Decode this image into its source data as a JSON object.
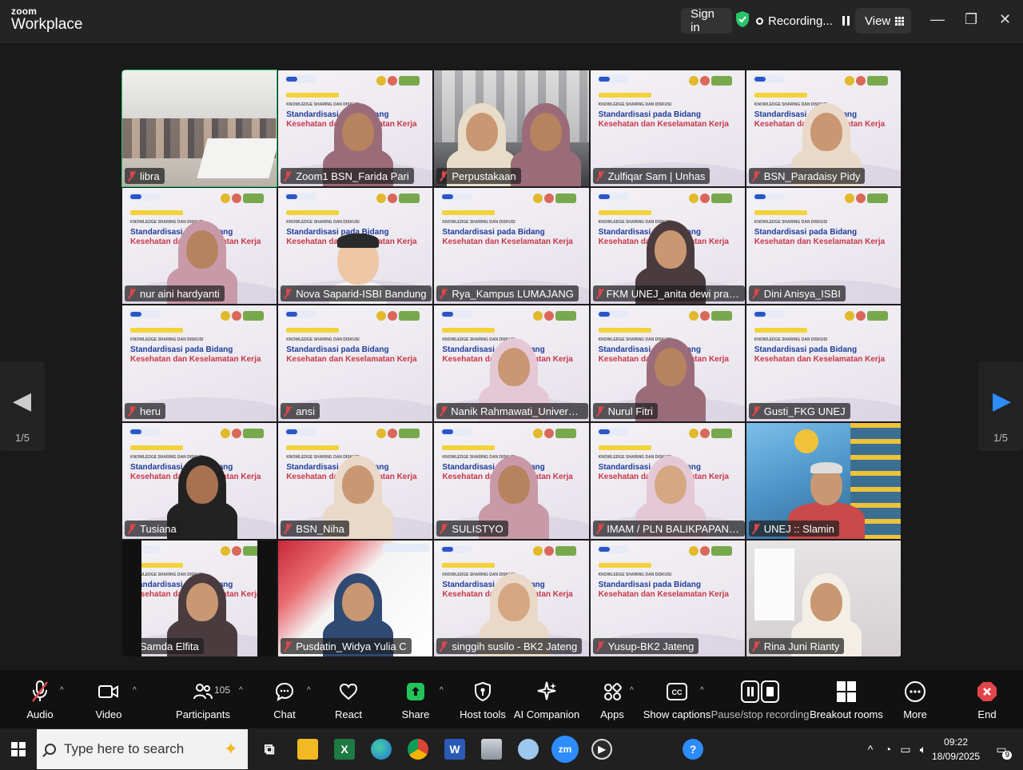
{
  "app": {
    "brand_small": "zoom",
    "brand_large": "Workplace"
  },
  "titlebar": {
    "sign_in": "Sign in",
    "recording": "Recording...",
    "view": "View"
  },
  "nav": {
    "prev_page": "1/5",
    "next_page": "1/5"
  },
  "slide": {
    "t1": "KNOWLEDGE SHARING DAN DISKUSI",
    "t2": "Standardisasi pada Bidang",
    "t3": "Kesehatan dan Keselamatan Kerja"
  },
  "participants": [
    {
      "name": "libra",
      "kind": "room",
      "active": true
    },
    {
      "name": "Zoom1 BSN_Farida Pari",
      "kind": "slide-person"
    },
    {
      "name": "Perpustakaan",
      "kind": "library"
    },
    {
      "name": "Zulfiqar Sam | Unhas",
      "kind": "slide"
    },
    {
      "name": "BSN_Paradaisy Pidy",
      "kind": "slide-person"
    },
    {
      "name": "nur aini hardyanti",
      "kind": "slide-person"
    },
    {
      "name": "Nova Saparid-ISBI Bandung",
      "kind": "slide-avatar"
    },
    {
      "name": "Rya_Kampus LUMAJANG",
      "kind": "slide"
    },
    {
      "name": "FKM UNEJ_anita dewi prahastuti ...",
      "kind": "slide-person"
    },
    {
      "name": "Dini Anisya_ISBI",
      "kind": "slide"
    },
    {
      "name": "heru",
      "kind": "slide"
    },
    {
      "name": "ansi",
      "kind": "slide"
    },
    {
      "name": "Nanik Rahmawati_Universitas ...",
      "kind": "slide-person"
    },
    {
      "name": "Nurul Fitri",
      "kind": "slide-person"
    },
    {
      "name": "Gusti_FKG UNEJ",
      "kind": "slide"
    },
    {
      "name": "Tusiana",
      "kind": "slide-person"
    },
    {
      "name": "BSN_Niha",
      "kind": "slide-person"
    },
    {
      "name": "SULISTYO",
      "kind": "slide-person"
    },
    {
      "name": "IMAM / PLN BALIKPAPAN SEL...",
      "kind": "slide-person"
    },
    {
      "name": "UNEJ :: Slamin",
      "kind": "building"
    },
    {
      "name": "Samda Elfita",
      "kind": "slide-person"
    },
    {
      "name": "Pusdatin_Widya Yulia C",
      "kind": "red"
    },
    {
      "name": "singgih susilo - BK2 Jateng",
      "kind": "slide-person"
    },
    {
      "name": "Yusup-BK2 Jateng",
      "kind": "slide"
    },
    {
      "name": "Rina Juni Rianty",
      "kind": "plain"
    }
  ],
  "controls": {
    "audio": "Audio",
    "video": "Video",
    "participants": "Participants",
    "participants_count": "105",
    "chat": "Chat",
    "react": "React",
    "share": "Share",
    "host_tools": "Host tools",
    "ai_companion": "AI Companion",
    "apps": "Apps",
    "show_captions": "Show captions",
    "pause_recording": "Pause/stop recording",
    "breakout_rooms": "Breakout rooms",
    "more": "More",
    "end": "End"
  },
  "taskbar": {
    "search_placeholder": "Type here to search",
    "time": "09:22",
    "date": "18/09/2025",
    "notification_count": "9"
  },
  "colors": {
    "accent_green": "#29c46b",
    "share_green": "#23c45a",
    "end_red": "#e0464b",
    "slide_blue": "#1e3d9b",
    "slide_red": "#c8384a"
  }
}
